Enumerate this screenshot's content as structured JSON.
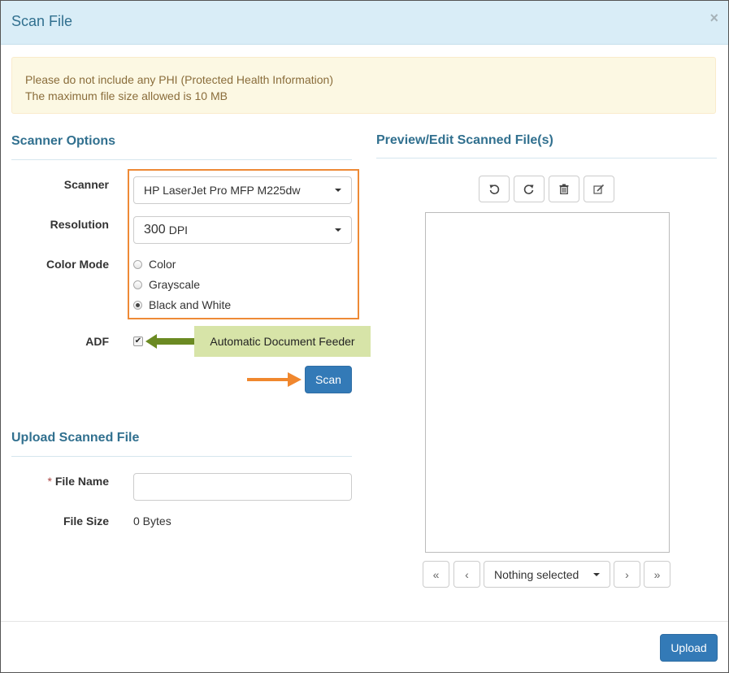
{
  "modal": {
    "title": "Scan File",
    "close_label": "×"
  },
  "alert": {
    "line1": "Please do not include any PHI (Protected Health Information)",
    "line2": "The maximum file size allowed is 10 MB"
  },
  "scanner_options": {
    "title": "Scanner Options",
    "scanner_label": "Scanner",
    "scanner_value": "HP LaserJet Pro MFP M225dw",
    "resolution_label": "Resolution",
    "resolution_number": "300",
    "resolution_unit": "DPI",
    "color_mode_label": "Color Mode",
    "color_modes": [
      {
        "label": "Color",
        "checked": false
      },
      {
        "label": "Grayscale",
        "checked": false
      },
      {
        "label": "Black and White",
        "checked": true
      }
    ],
    "adf_label": "ADF",
    "adf_checked": true,
    "adf_callout": "Automatic Document Feeder",
    "scan_button": "Scan",
    "highlight_color": "#ee8a36"
  },
  "upload": {
    "title": "Upload Scanned File",
    "required_mark": "*",
    "file_name_label": "File Name",
    "file_name_value": "",
    "file_size_label": "File Size",
    "file_size_value": "0 Bytes"
  },
  "preview": {
    "title": "Preview/Edit Scanned File(s)",
    "toolbar_icons": [
      "rotate-left-icon",
      "rotate-right-icon",
      "trash-icon",
      "edit-icon"
    ],
    "page_select": "Nothing selected"
  },
  "footer": {
    "upload_button": "Upload"
  },
  "colors": {
    "header_bg": "#d9edf7",
    "title_color": "#31708f",
    "primary": "#337ab7",
    "alert_bg": "#fcf8e3",
    "callout_bg": "#d7e4a8",
    "arrow_green": "#6b8a22",
    "arrow_orange": "#f0872e"
  }
}
